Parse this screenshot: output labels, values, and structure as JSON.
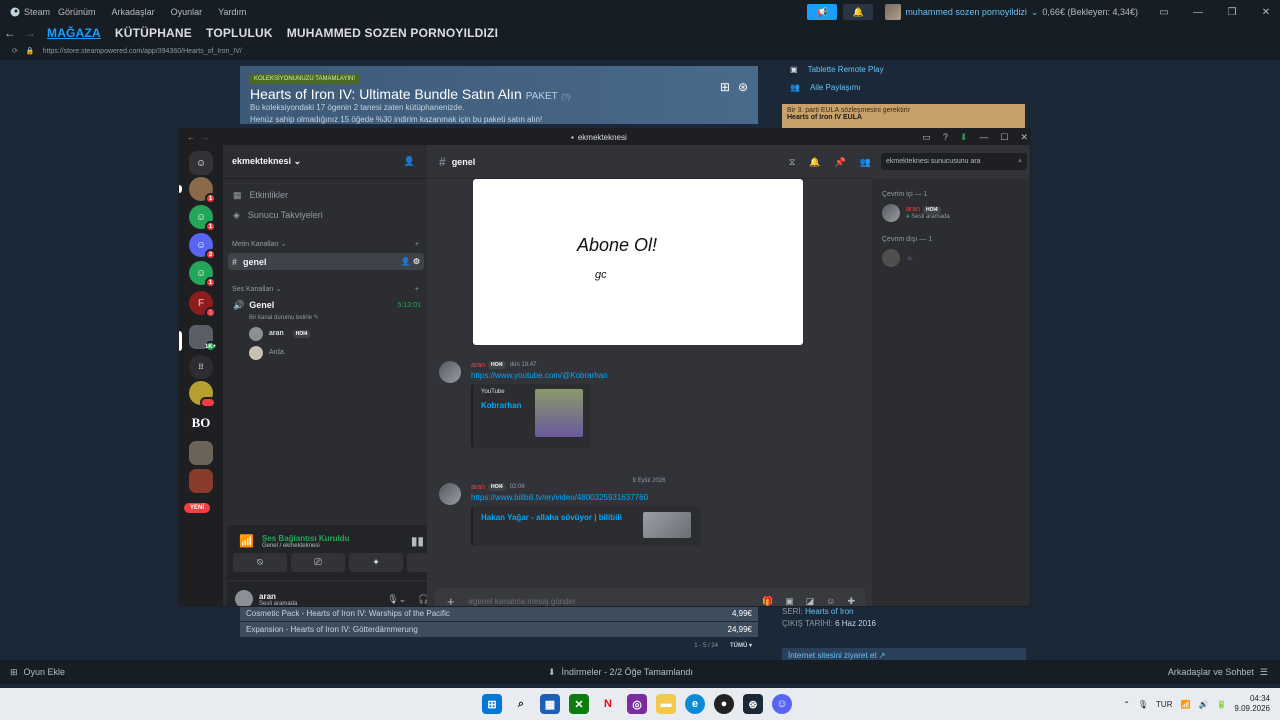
{
  "steam": {
    "menu": [
      "Steam",
      "Görünüm",
      "Arkadaşlar",
      "Oyunlar",
      "Yardım"
    ],
    "user": "muhammed sozen pornoyildizi",
    "wallet": "0,66€ (Bekleyen: 4,34€)",
    "nav": [
      "MAĞAZA",
      "KÜTÜPHANE",
      "TOPLULUK",
      "MUHAMMED SOZEN PORNOYILDIZI"
    ],
    "url": "https://store.steampowered.com/app/394360/Hearts_of_Iron_IV/",
    "bundle": {
      "badge": "KOLEKSİYONUNUZU TAMAMLAYIN!",
      "title": "Hearts of Iron IV: Ultimate Bundle Satın Alın",
      "tag": "PAKET",
      "tag_q": "(?)",
      "line1": "Bu koleksiyondaki 17 ögenin 2 tanesi zaten kütüphanenizde.",
      "line2": "Henüz sahip olmadığınız 15 öğede %30 indirim kazanmak için bu paketi satın alın!"
    },
    "side_items": [
      "Tablette Remote Play",
      "Aile Paylaşımı"
    ],
    "eula": {
      "line1": "Bir 3. parti EULA sözleşmesini gerektirir",
      "line2": "Hearts of Iron IV EULA"
    },
    "dlc_rows": [
      {
        "name": "Cosmetic Pack - Hearts of Iron IV: Warships of the Pacific",
        "price": "4,99€"
      },
      {
        "name": "Expansion - Hearts of Iron IV: Götterdämmerung",
        "price": "24,99€"
      }
    ],
    "dlc_pager": "1 - 5 / 24",
    "dlc_all": "TÜMÜ ▾",
    "meta": {
      "series_label": "SERİ:",
      "series": "Hearts of Iron",
      "release_label": "ÇIKIŞ TARİHİ:",
      "release": "6 Haz 2016",
      "site": "İnternet sitesini ziyaret et"
    },
    "bottom": {
      "add_game": "Oyun Ekle",
      "downloads": "İndirmeler - 2/2 Öğe Tamamlandı",
      "friends": "Arkadaşlar ve Sohbet"
    }
  },
  "discord": {
    "window_title": "ekmekteknesi",
    "server_name": "ekmekteknesi",
    "guild_new": "YENİ",
    "guild_badges": [
      "1",
      "1",
      "2",
      "1",
      "1",
      "1K+"
    ],
    "top_items": [
      "Etkinlikler",
      "Sunucu Takviyeleri"
    ],
    "text_category": "Metin Kanalları",
    "text_channel": "genel",
    "voice_category": "Ses Kanalları",
    "voice_channel": "Genel",
    "voice_time": "5:13:01",
    "voice_status": "Bir kanal durumu belirle",
    "voice_users": [
      {
        "name": "aran",
        "tag": "HOI4"
      },
      {
        "name": "Arda."
      }
    ],
    "voice_panel": {
      "status": "Ses Bağlantısı Kuruldu",
      "sub": "Genel / ekmekteknesi"
    },
    "user": {
      "name": "aran",
      "status": "Sesli aramada"
    },
    "channel_header": "genel",
    "search_placeholder": "ekmekteknesi sunucusunu ara",
    "drawing_text": {
      "big": "Abone Ol!",
      "small": "gc"
    },
    "messages": [
      {
        "author": "aran",
        "tag": "HOI4",
        "time": "dün 19:47",
        "link": "https://www.youtube.com/@Kobrarhan",
        "embed_provider": "YouTube",
        "embed_title": "Kobrarhan"
      },
      {
        "author": "aran",
        "tag": "HOI4",
        "time": "02:06",
        "link": "https://www.bilibili.tv/en/video/4800325931637760",
        "embed_title": "Hakan Yağar - allaha sövüyor | bilibili"
      }
    ],
    "date_divider": "9 Eylül 2026",
    "composer_placeholder": "#genel kanalına mesaj gönder",
    "members": {
      "online_header": "Çevrim içi — 1",
      "online": [
        {
          "name": "aran",
          "tag": "HOI4",
          "status": "Sesli aramada"
        }
      ],
      "offline_header": "Çevrim dışı — 1"
    }
  },
  "taskbar": {
    "lang": "TUR",
    "time": "04:34",
    "date": "9.09.2026"
  },
  "colors": {
    "steam_bg": "#1b2838",
    "steam_accent": "#1a9fff",
    "discord_bg": "#313338",
    "discord_side": "#2b2d31",
    "discord_guilds": "#1e1f22",
    "voice_green": "#23a55a",
    "link": "#00a8fc",
    "mention_red": "#f23f43"
  }
}
